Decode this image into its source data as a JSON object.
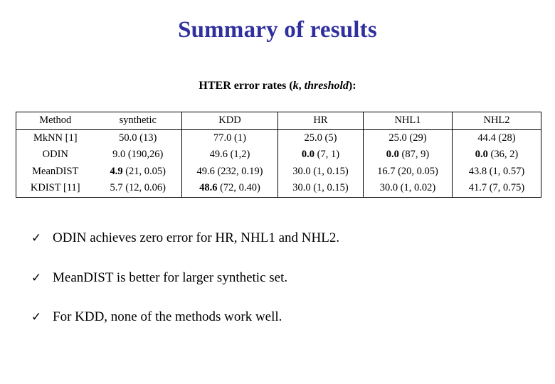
{
  "slide": {
    "title": "Summary of results",
    "title_color": "#2f2f9e",
    "subtitle_parts": {
      "lead": "HTER error rates (",
      "k": "k",
      "comma": ", ",
      "threshold": "threshold",
      "tail": "):"
    },
    "subtitle_full": "HTER error rates (k, threshold):"
  },
  "table": {
    "headers": [
      "Method",
      "synthetic",
      "KDD",
      "HR",
      "NHL1",
      "NHL2"
    ],
    "rows": [
      {
        "method": "MkNN [1]",
        "cells": [
          {
            "value": "50.0",
            "params": " (13)",
            "bold": false
          },
          {
            "value": "77.0",
            "params": " (1)",
            "bold": false
          },
          {
            "value": "25.0",
            "params": " (5)",
            "bold": false
          },
          {
            "value": "25.0",
            "params": " (29)",
            "bold": false
          },
          {
            "value": "44.4",
            "params": " (28)",
            "bold": false
          }
        ]
      },
      {
        "method": "ODIN",
        "cells": [
          {
            "value": "9.0",
            "params": " (190,26)",
            "bold": false
          },
          {
            "value": "49.6",
            "params": " (1,2)",
            "bold": false
          },
          {
            "value": "0.0",
            "params": " (7, 1)",
            "bold": true
          },
          {
            "value": "0.0",
            "params": " (87, 9)",
            "bold": true
          },
          {
            "value": "0.0",
            "params": " (36, 2)",
            "bold": true
          }
        ]
      },
      {
        "method": "MeanDIST",
        "cells": [
          {
            "value": "4.9",
            "params": " (21, 0.05)",
            "bold": true
          },
          {
            "value": "49.6",
            "params": " (232, 0.19)",
            "bold": false
          },
          {
            "value": "30.0",
            "params": " (1, 0.15)",
            "bold": false
          },
          {
            "value": "16.7",
            "params": " (20, 0.05)",
            "bold": false
          },
          {
            "value": "43.8",
            "params": " (1, 0.57)",
            "bold": false
          }
        ]
      },
      {
        "method": "KDIST [11]",
        "cells": [
          {
            "value": "5.7",
            "params": " (12, 0.06)",
            "bold": false
          },
          {
            "value": "48.6",
            "params": " (72, 0.40)",
            "bold": true
          },
          {
            "value": "30.0",
            "params": " (1, 0.15)",
            "bold": false
          },
          {
            "value": "30.0",
            "params": " (1, 0.02)",
            "bold": false
          },
          {
            "value": "41.7",
            "params": " (7, 0.75)",
            "bold": false
          }
        ]
      }
    ]
  },
  "bullets": {
    "marker": "✓",
    "items": [
      "ODIN achieves zero error for HR, NHL1 and NHL2.",
      "MeanDIST is better for larger synthetic set.",
      "For KDD, none of the methods work well."
    ]
  }
}
